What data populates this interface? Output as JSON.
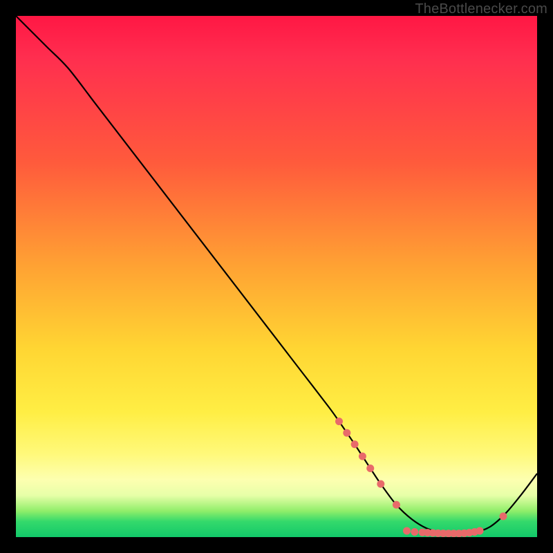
{
  "watermark": "TheBottlenecker.com",
  "colors": {
    "frame": "#000000",
    "curve": "#000000",
    "marker": "#e86a6a",
    "gradient_top": "#ff1744",
    "gradient_bottom": "#12c96a"
  },
  "chart_data": {
    "type": "line",
    "title": "",
    "xlabel": "",
    "ylabel": "",
    "xlim": [
      0,
      100
    ],
    "ylim": [
      0,
      100
    ],
    "series": [
      {
        "name": "curve",
        "x": [
          0,
          3,
          6,
          10,
          15,
          20,
          25,
          30,
          35,
          40,
          45,
          50,
          55,
          60,
          62,
          65,
          68,
          70,
          73,
          76,
          79,
          82,
          85,
          88,
          91,
          94,
          97,
          100
        ],
        "y": [
          100,
          97,
          94,
          90,
          83.5,
          77,
          70.5,
          64,
          57.5,
          51,
          44.5,
          38,
          31.5,
          25,
          22.2,
          17.8,
          13.2,
          10.2,
          6.2,
          3.4,
          1.6,
          0.8,
          0.6,
          0.9,
          2.0,
          4.6,
          8.2,
          12.2
        ]
      }
    ],
    "markers": [
      {
        "x": 62.0,
        "y": 22.2
      },
      {
        "x": 63.5,
        "y": 20.0
      },
      {
        "x": 65.0,
        "y": 17.8
      },
      {
        "x": 66.5,
        "y": 15.5
      },
      {
        "x": 68.0,
        "y": 13.2
      },
      {
        "x": 70.0,
        "y": 10.2
      },
      {
        "x": 73.0,
        "y": 6.2
      },
      {
        "x": 75.0,
        "y": 1.2
      },
      {
        "x": 76.5,
        "y": 1.0
      },
      {
        "x": 78.0,
        "y": 0.9
      },
      {
        "x": 79.0,
        "y": 0.85
      },
      {
        "x": 80.0,
        "y": 0.8
      },
      {
        "x": 81.0,
        "y": 0.75
      },
      {
        "x": 82.0,
        "y": 0.72
      },
      {
        "x": 83.0,
        "y": 0.7
      },
      {
        "x": 84.0,
        "y": 0.7
      },
      {
        "x": 85.0,
        "y": 0.7
      },
      {
        "x": 86.0,
        "y": 0.75
      },
      {
        "x": 87.0,
        "y": 0.85
      },
      {
        "x": 88.0,
        "y": 1.0
      },
      {
        "x": 89.0,
        "y": 1.2
      },
      {
        "x": 93.5,
        "y": 4.0
      }
    ]
  }
}
